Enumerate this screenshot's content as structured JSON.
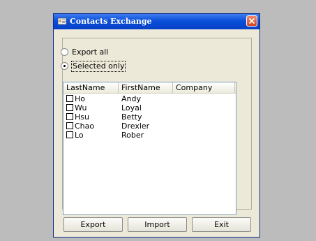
{
  "window": {
    "title": "Contacts Exchange"
  },
  "options": {
    "export_all": "Export all",
    "selected_only": "Selected only",
    "selected": "selected_only"
  },
  "list": {
    "columns": [
      "LastName",
      "FirstName",
      "Company"
    ],
    "rows": [
      {
        "checked": false,
        "last": "Ho",
        "first": "Andy",
        "company": ""
      },
      {
        "checked": false,
        "last": "Wu",
        "first": "Loyal",
        "company": ""
      },
      {
        "checked": false,
        "last": "Hsu",
        "first": "Betty",
        "company": ""
      },
      {
        "checked": false,
        "last": "Chao",
        "first": "Drexler",
        "company": ""
      },
      {
        "checked": false,
        "last": "Lo",
        "first": "Rober",
        "company": ""
      }
    ]
  },
  "buttons": {
    "export": "Export",
    "import": "Import",
    "exit": "Exit"
  },
  "colors": {
    "titlebar": "#0a4fd8",
    "window_bg": "#ece9d8",
    "close": "#d44420"
  },
  "icons": {
    "title": "contacts-app-icon",
    "close": "close-icon"
  }
}
